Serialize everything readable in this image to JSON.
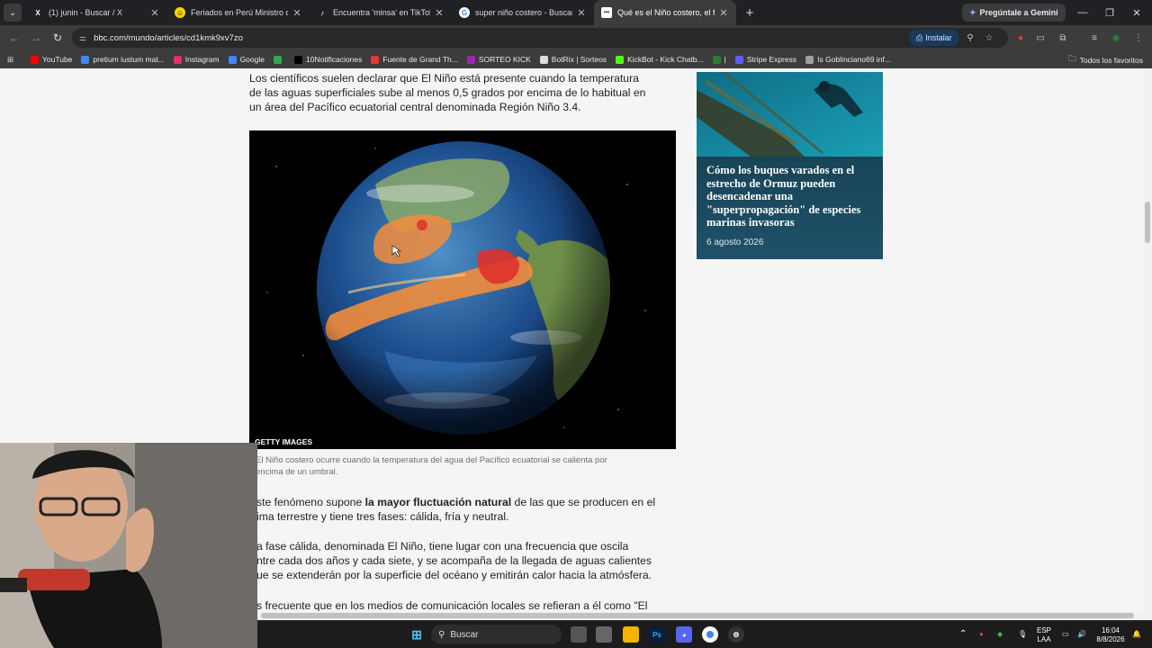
{
  "browser": {
    "tabs": [
      {
        "title": "(1) junin - Buscar / X",
        "icon": "x-logo",
        "active": false
      },
      {
        "title": "Feriados en Perú Ministro de Ec",
        "icon": "smiley-favicon",
        "active": false
      },
      {
        "title": "Encuentra 'minsa' en TikTok | B",
        "icon": "tiktok-logo",
        "active": false
      },
      {
        "title": "super niño costero - Buscar con",
        "icon": "google-logo",
        "active": false
      },
      {
        "title": "Qué es el Niño costero, el fenó",
        "icon": "bbc-logo",
        "active": true
      }
    ],
    "gemini_label": "Pregúntale a Gemini",
    "url": "bbc.com/mundo/articles/cd1kmk9xv7zo",
    "install_label": "Instalar",
    "bookmarks": [
      {
        "label": "YouTube",
        "color": "#ff0000"
      },
      {
        "label": "pretium iustum mat...",
        "color": "#4285f4"
      },
      {
        "label": "Instagram",
        "color": "#e1306c"
      },
      {
        "label": "Google",
        "color": "#4285f4"
      },
      {
        "label": "",
        "color": "#34a853"
      },
      {
        "label": "10Notificaciones",
        "color": "#000000"
      },
      {
        "label": "Fuente de Grand Th...",
        "color": "#e53935"
      },
      {
        "label": "SORTEO KICK",
        "color": "#9c27b0"
      },
      {
        "label": "BotRix | Sorteos",
        "color": "#dddddd"
      },
      {
        "label": "KickBot - Kick Chatb...",
        "color": "#53fc18"
      },
      {
        "label": "|",
        "color": "#2e7d32"
      },
      {
        "label": "Stripe Express",
        "color": "#635bff"
      },
      {
        "label": "Is Goblinciano69 inf...",
        "color": "#9e9e9e"
      }
    ],
    "all_bookmarks": "Todos los favoritos"
  },
  "article": {
    "intro_lines": [
      "Los científicos suelen declarar que El Niño está presente cuando la temperatura",
      "de las aguas superficiales sube al menos 0,5 grados por encima de lo habitual en",
      "un área del Pacífico ecuatorial central denominada Región Niño 3.4."
    ],
    "image_credit": "GETTY IMAGES",
    "caption_lines": [
      "El Niño costero ocurre cuando la temperatura del agua del Pacífico ecuatorial se calienta por",
      "encima de un umbral."
    ],
    "p2_line1_pre": "ste fenómeno supone ",
    "p2_line1_bold": "la mayor fluctuación natural",
    "p2_line1_post": " de las que se producen en el",
    "p2_line2": "ima terrestre y tiene tres fases: cálida, fría y neutral.",
    "p3_lines": [
      "a fase cálida, denominada El Niño, tiene lugar con una frecuencia que oscila",
      "ntre cada dos años y cada siete, y se acompaña de la llegada de aguas calientes",
      "ue se extenderán por la superficie del océano y emitirán calor hacia la atmósfera."
    ],
    "p4_line1": "s frecuente que en los medios de comunicación locales se refieran a él como \"El"
  },
  "sidebar_card": {
    "title": "Cómo los buques varados en el estrecho de Ormuz pueden desencadenar una \"superpropagación\" de especies marinas invasoras",
    "date": "6 agosto 2026"
  },
  "taskbar": {
    "search_label": "Buscar",
    "lang_top": "ESP",
    "lang_bottom": "LAA",
    "time": "16:04",
    "date": "8/8/2026"
  }
}
